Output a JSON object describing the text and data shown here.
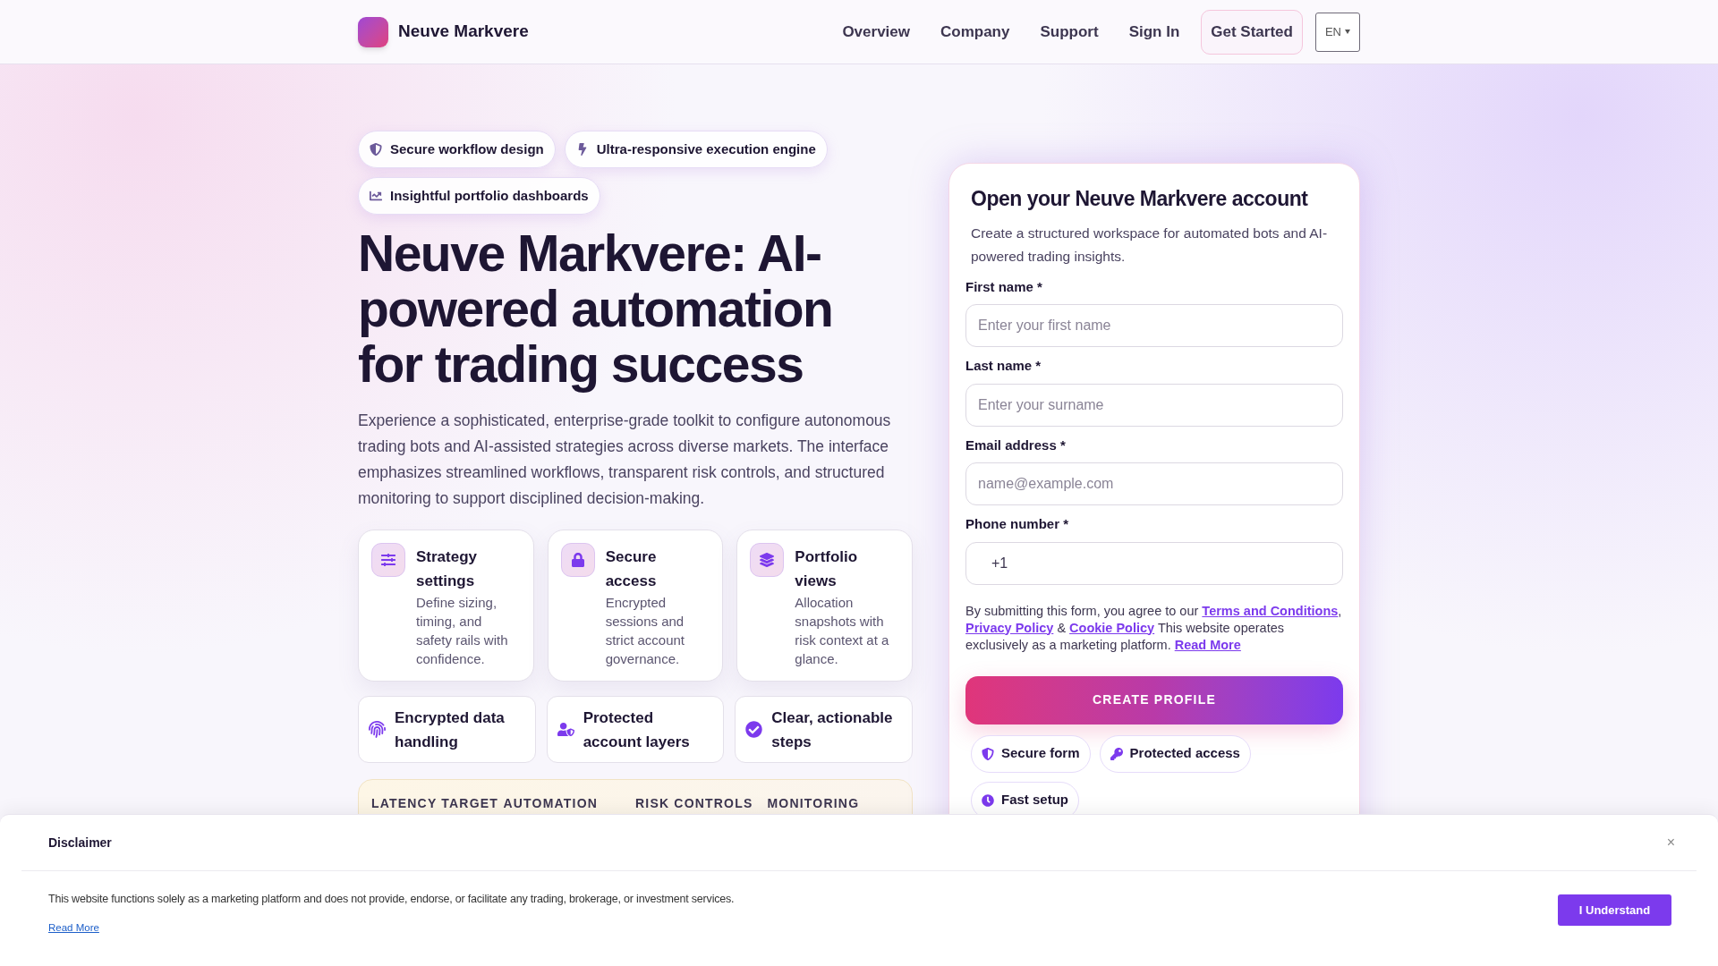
{
  "header": {
    "brand": "Neuve Markvere",
    "nav": [
      "Overview",
      "Company",
      "Support",
      "Sign In"
    ],
    "cta": "Get Started",
    "language": "EN"
  },
  "badges": [
    {
      "label": "Secure workflow design"
    },
    {
      "label": "Ultra-responsive execution engine"
    },
    {
      "label": "Insightful portfolio dashboards"
    }
  ],
  "hero": {
    "title": "Neuve Markvere: AI-powered automation for trading success",
    "text": "Experience a sophisticated, enterprise-grade toolkit to configure autonomous trading bots and AI-assisted strategies across diverse markets. The interface emphasizes streamlined workflows, transparent risk controls, and structured monitoring to support disciplined decision-making."
  },
  "features": [
    {
      "title": "Strategy settings",
      "text": "Define sizing, timing, and safety rails with confidence."
    },
    {
      "title": "Secure access",
      "text": "Encrypted sessions and strict account governance."
    },
    {
      "title": "Portfolio views",
      "text": "Allocation snapshots with risk context at a glance."
    }
  ],
  "highlights": [
    {
      "text": "Encrypted data handling"
    },
    {
      "text": "Protected account layers"
    },
    {
      "text": "Clear, actionable steps"
    }
  ],
  "stats": {
    "columns": [
      "LATENCY TARGET",
      "AUTOMATION",
      "RISK CONTROLS",
      "MONITORING"
    ]
  },
  "form": {
    "title": "Open your Neuve Markvere account",
    "subtitle": "Create a structured workspace for automated bots and AI-powered trading insights.",
    "fields": [
      {
        "label": "First name *",
        "placeholder": "Enter your first name"
      },
      {
        "label": "Last name *",
        "placeholder": "Enter your surname"
      },
      {
        "label": "Email address *",
        "placeholder": "name@example.com"
      },
      {
        "label": "Phone number *",
        "prefix": "+1"
      }
    ],
    "consent": [
      {
        "kind": "text",
        "text": "By submitting this form, you agree to our"
      },
      {
        "kind": "link",
        "text": "Terms and Conditions"
      },
      {
        "kind": "text",
        "text": ","
      },
      {
        "kind": "link",
        "text": "Privacy Policy"
      },
      {
        "kind": "text",
        "text": "&"
      },
      {
        "kind": "link",
        "text": "Cookie Policy"
      },
      {
        "kind": "text",
        "text": "This website operates exclusively as a marketing platform."
      },
      {
        "kind": "link",
        "text": "Read More"
      }
    ],
    "submit": "CREATE PROFILE",
    "pills": [
      {
        "label": "Secure form"
      },
      {
        "label": "Protected access"
      },
      {
        "label": "Fast setup"
      }
    ]
  },
  "disclaimer": {
    "title": "Disclaimer",
    "close": "×",
    "text": "This website functions solely as a marketing platform and does not provide, endorse, or facilitate any trading, brokerage, or investment services.",
    "link": "Read More",
    "button": "I Understand"
  }
}
